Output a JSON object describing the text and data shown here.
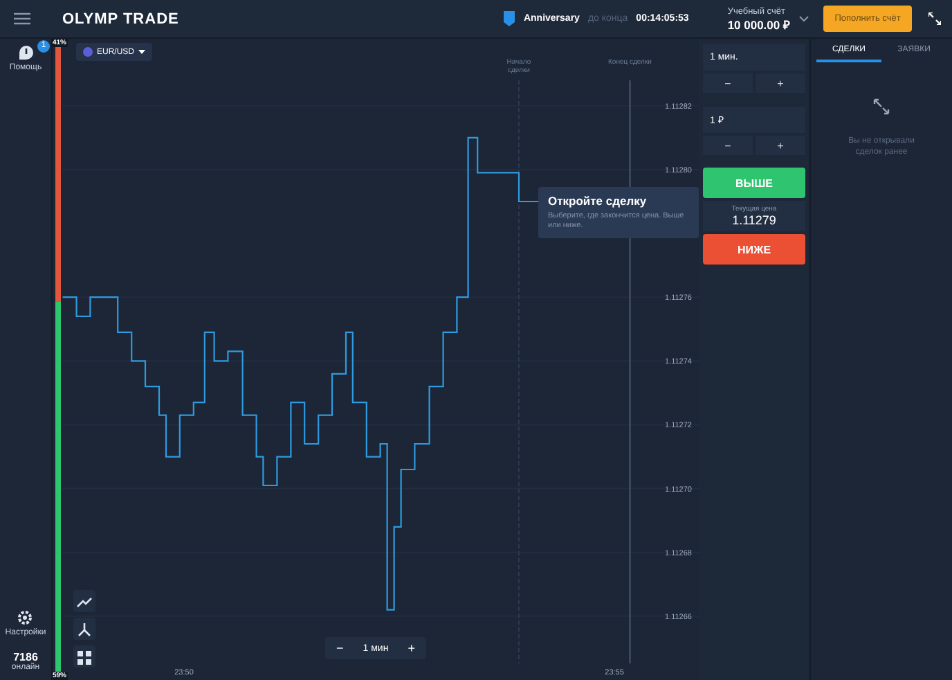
{
  "topbar": {
    "logo": "OLYMP TRADE",
    "promo": {
      "title": "Anniversary",
      "caption": "до конца",
      "timer": "00:14:05:53"
    },
    "account": {
      "label": "Учебный счёт",
      "balance": "10 000.00 ₽"
    },
    "deposit_button": "Пополнить счёт"
  },
  "sidebar": {
    "items": [
      {
        "kind": "help",
        "label": "Помощь",
        "badge": "1"
      },
      {
        "kind": "settings",
        "label": "Настройки"
      }
    ],
    "online": {
      "count": "7186",
      "label": "онлайн"
    }
  },
  "sentiment": {
    "up": "59%",
    "down": "41%",
    "level": 0.59
  },
  "asset": {
    "name": "EUR/USD"
  },
  "chart": {
    "tooltip": {
      "title": "Откройте сделку",
      "text": "Выберите, где закончится цена. Выше или ниже."
    },
    "timeframe": {
      "minus": "−",
      "value": "1 мин",
      "plus": "+"
    },
    "chart_data": {
      "type": "line",
      "x": [
        1428.59,
        1428.75,
        1428.75,
        1428.91,
        1428.91,
        1429.23,
        1429.23,
        1429.39,
        1429.39,
        1429.55,
        1429.55,
        1429.71,
        1429.71,
        1429.79,
        1429.79,
        1429.95,
        1429.95,
        1430.11,
        1430.11,
        1430.24,
        1430.24,
        1430.35,
        1430.35,
        1430.51,
        1430.51,
        1430.68,
        1430.68,
        1430.84,
        1430.84,
        1430.92,
        1430.92,
        1431.08,
        1431.08,
        1431.24,
        1431.24,
        1431.4,
        1431.4,
        1431.56,
        1431.56,
        1431.72,
        1431.72,
        1431.88,
        1431.88,
        1431.96,
        1431.96,
        1432.12,
        1432.12,
        1432.28,
        1432.28,
        1432.36,
        1432.36,
        1432.44,
        1432.44,
        1432.52,
        1432.52,
        1432.68,
        1432.68,
        1432.85,
        1432.85,
        1433.01,
        1433.01,
        1433.17,
        1433.17,
        1433.3,
        1433.3,
        1433.41,
        1433.41,
        1433.73,
        1433.89,
        1433.89,
        1434.13
      ],
      "values": [
        1.11276,
        1.11276,
        1.112754,
        1.112754,
        1.11276,
        1.11276,
        1.112749,
        1.112749,
        1.11274,
        1.11274,
        1.112732,
        1.112732,
        1.112723,
        1.112723,
        1.11271,
        1.11271,
        1.112723,
        1.112723,
        1.112727,
        1.112727,
        1.112749,
        1.112749,
        1.11274,
        1.11274,
        1.112743,
        1.112743,
        1.112723,
        1.112723,
        1.11271,
        1.11271,
        1.112701,
        1.112701,
        1.11271,
        1.11271,
        1.112727,
        1.112727,
        1.112714,
        1.112714,
        1.112723,
        1.112723,
        1.112736,
        1.112736,
        1.112749,
        1.112749,
        1.112727,
        1.112727,
        1.11271,
        1.11271,
        1.112714,
        1.112714,
        1.112662,
        1.112662,
        1.112688,
        1.112688,
        1.112706,
        1.112706,
        1.112714,
        1.112714,
        1.112732,
        1.112732,
        1.112749,
        1.112749,
        1.11276,
        1.11276,
        1.11281,
        1.11281,
        1.112799,
        1.112799,
        1.112799,
        1.11279,
        1.11279
      ],
      "xlim": [
        1428.585,
        1435.98
      ],
      "ylim": [
        1.11264,
        1.112841
      ],
      "xticks": [
        {
          "value": 1430,
          "label": "23:50"
        },
        {
          "value": 1435,
          "label": "23:55"
        }
      ],
      "grid": true,
      "ref_lines": [
        {
          "axis": "x",
          "value": 1433.89,
          "label": "Начало сделки"
        },
        {
          "axis": "x",
          "value": 1435.18,
          "label": "Конец сделки"
        }
      ],
      "yticks": [
        {
          "value": 1.11282,
          "label": "1.11282"
        },
        {
          "value": 1.1128,
          "label": "1.11280"
        },
        {
          "value": 1.11276,
          "label": "1.11276"
        },
        {
          "value": 1.11274,
          "label": "1.11274"
        },
        {
          "value": 1.11272,
          "label": "1.11272"
        },
        {
          "value": 1.1127,
          "label": "1.11270"
        },
        {
          "value": 1.11268,
          "label": "1.11268"
        },
        {
          "value": 1.11266,
          "label": "1.11266"
        }
      ]
    }
  },
  "trade": {
    "duration": {
      "value": "1 мин.",
      "minus": "−",
      "plus": "+"
    },
    "amount": {
      "value": "1 ₽",
      "minus": "−",
      "plus": "+"
    },
    "up_button": "ВЫШЕ",
    "price_label": "Текущая цена",
    "price": "1.11279",
    "down_button": "НИЖЕ"
  },
  "deals": {
    "tabs": [
      {
        "label": "СДЕЛКИ",
        "selected": true
      },
      {
        "label": "ЗАЯВКИ",
        "selected": false
      }
    ],
    "empty_text": "Вы не открывали сделок ранее"
  }
}
